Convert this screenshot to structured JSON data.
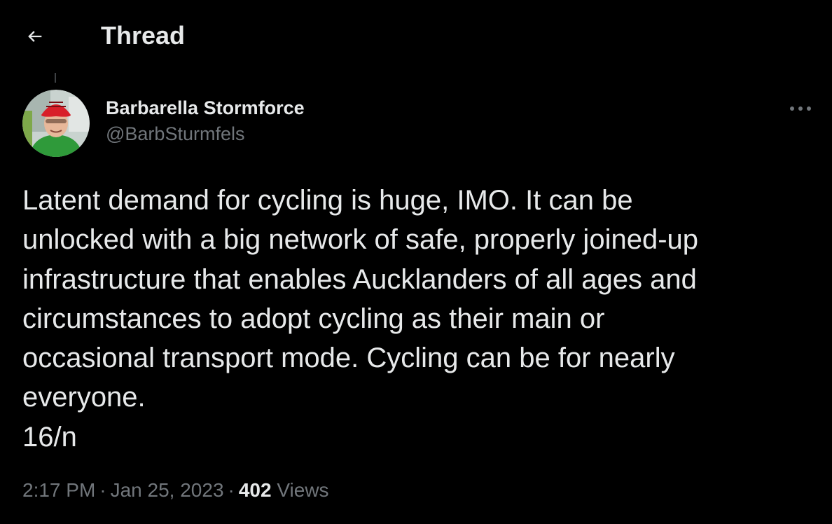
{
  "header": {
    "title": "Thread",
    "back_icon": "arrow-left-icon"
  },
  "tweet": {
    "author": {
      "display_name": "Barbarella Stormforce",
      "handle": "@BarbSturmfels"
    },
    "text": "Latent demand for cycling is huge, IMO. It can be\nunlocked with a big network of safe, properly joined-up\ninfrastructure that enables Aucklanders of all ages and\ncircumstances to adopt cycling as their main or\noccasional transport mode. Cycling can be for nearly\neveryone.\n16/n",
    "time": "2:17 PM",
    "separator": "·",
    "date": "Jan 25, 2023",
    "views_count": "402",
    "views_label": "Views",
    "more_icon": "more-horizontal-icon"
  },
  "colors": {
    "background": "#000000",
    "primary_text": "#e7e9ea",
    "secondary_text": "#71767b"
  }
}
